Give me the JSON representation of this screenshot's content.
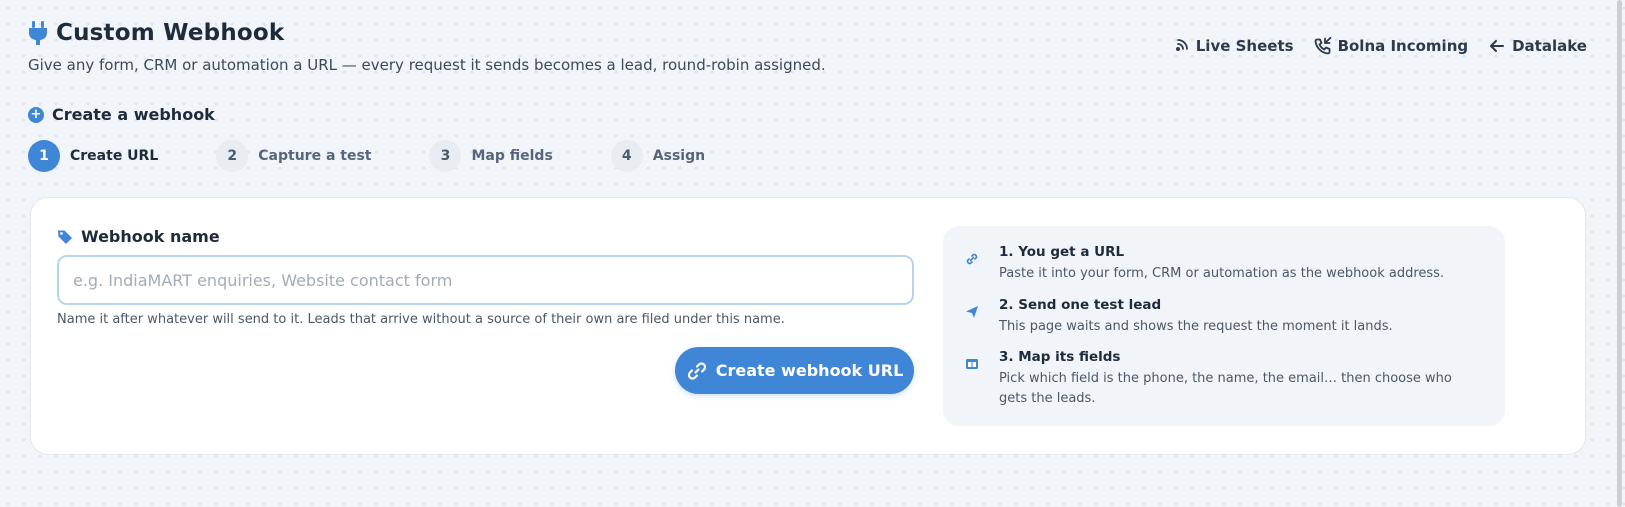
{
  "header": {
    "title": "Custom Webhook",
    "subtitle": "Give any form, CRM or automation a URL — every request it sends becomes a lead, round-robin assigned."
  },
  "top_links": [
    {
      "label": "Live Sheets",
      "icon": "broadcast-icon"
    },
    {
      "label": "Bolna Incoming",
      "icon": "phone-incoming-icon"
    },
    {
      "label": "Datalake",
      "icon": "arrow-left-icon"
    }
  ],
  "create_section": {
    "label": "Create a webhook"
  },
  "steps": [
    {
      "num": "1",
      "label": "Create URL",
      "active": true
    },
    {
      "num": "2",
      "label": "Capture a test",
      "active": false
    },
    {
      "num": "3",
      "label": "Map fields",
      "active": false
    },
    {
      "num": "4",
      "label": "Assign",
      "active": false
    }
  ],
  "form": {
    "label": "Webhook name",
    "placeholder": "e.g. IndiaMART enquiries, Website contact form",
    "value": "",
    "hint": "Name it after whatever will send to it. Leads that arrive without a source of their own are filed under this name.",
    "button_label": "Create webhook URL"
  },
  "info": [
    {
      "title": "1. You get a URL",
      "desc": "Paste it into your form, CRM or automation as the webhook address.",
      "icon": "link-icon"
    },
    {
      "title": "2. Send one test lead",
      "desc": "This page waits and shows the request the moment it lands.",
      "icon": "send-icon"
    },
    {
      "title": "3. Map its fields",
      "desc": "Pick which field is the phone, the name, the email… then choose who gets the leads.",
      "icon": "columns-icon"
    }
  ],
  "colors": {
    "accent": "#3f86d6",
    "background": "#f1f4f8",
    "text": "#1d2b3a"
  }
}
